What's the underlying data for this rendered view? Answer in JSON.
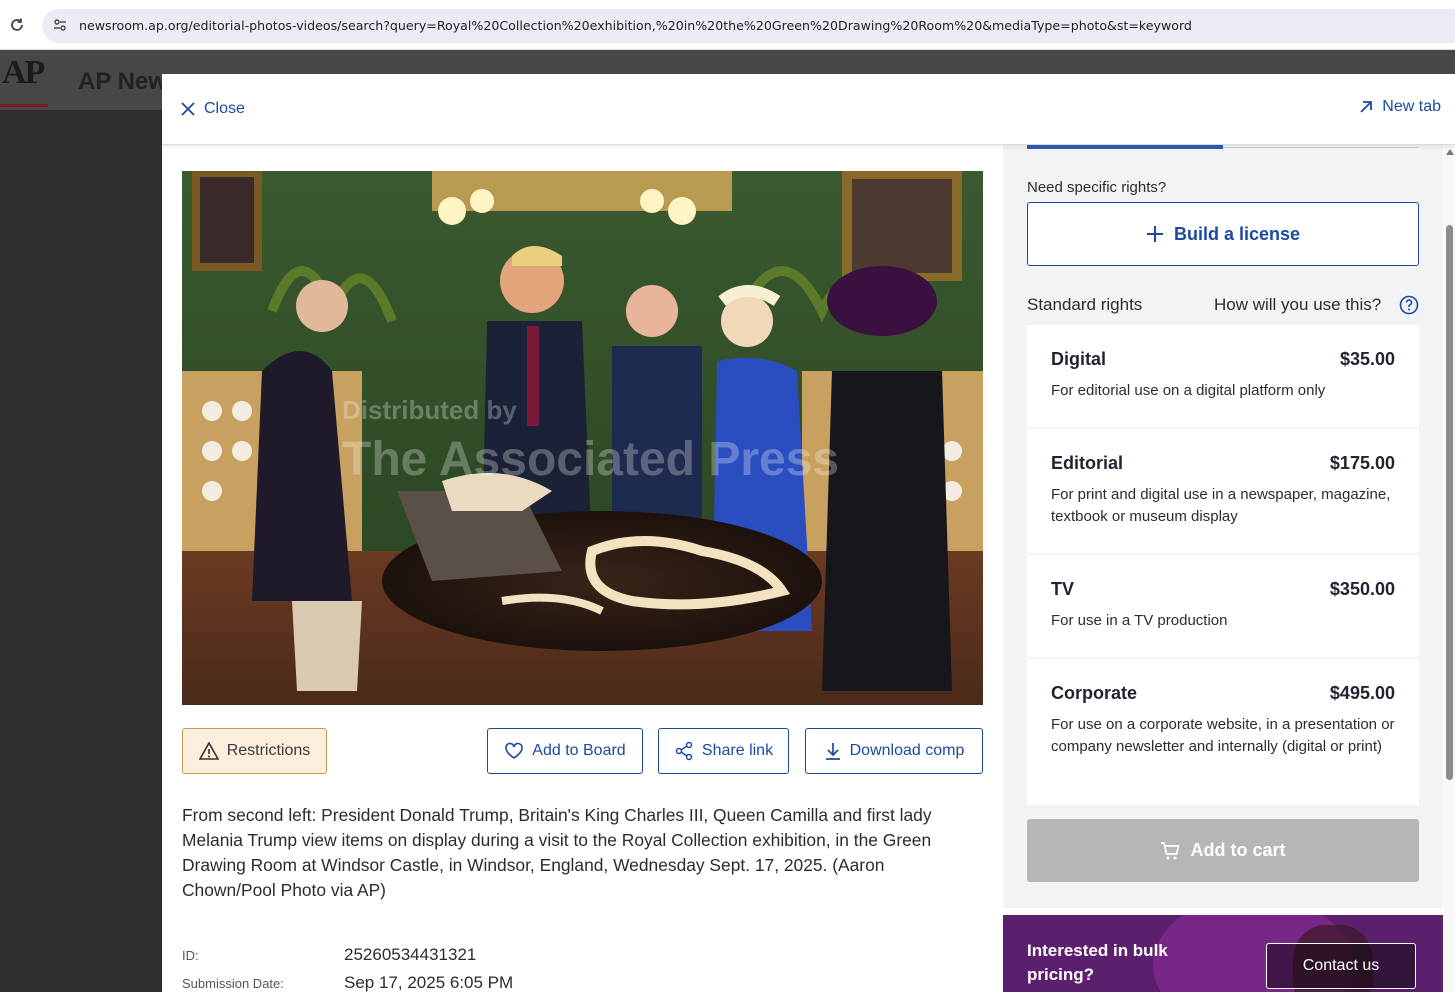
{
  "browser": {
    "url": "newsroom.ap.org/editorial-photos-videos/search?query=Royal%20Collection%20exhibition,%20in%20the%20Green%20Drawing%20Room%20&mediaType=photo&st=keyword"
  },
  "background": {
    "logo": "AP",
    "title": "AP News"
  },
  "modal": {
    "close_label": "Close",
    "newtab_label": "New tab",
    "photo": {
      "watermark_line1": "Distributed by",
      "watermark_line2": "The Associated Press"
    },
    "actions": {
      "restrictions": "Restrictions",
      "add_to_board": "Add to Board",
      "share_link": "Share link",
      "download_comp": "Download comp"
    },
    "caption": "From second left: President Donald Trump, Britain's King Charles III, Queen Camilla and first lady Melania Trump view items on display during a visit to the Royal Collection exhibition, in the Green Drawing Room at Windsor Castle, in Windsor, England, Wednesday Sept. 17, 2025. (Aaron Chown/Pool Photo via AP)",
    "meta": [
      {
        "key": "ID:",
        "value": "25260534431321"
      },
      {
        "key": "Submission Date:",
        "value": "Sep 17, 2025 6:05 PM"
      }
    ]
  },
  "licensing": {
    "need_label": "Need specific rights?",
    "build_license": "Build a license",
    "standard_rights": "Standard rights",
    "how_use": "How will you use this?",
    "rights": [
      {
        "name": "Digital",
        "price": "$35.00",
        "desc": "For editorial use on a digital platform only"
      },
      {
        "name": "Editorial",
        "price": "$175.00",
        "desc": "For print and digital use in a newspaper, magazine, textbook or museum display"
      },
      {
        "name": "TV",
        "price": "$350.00",
        "desc": "For use in a TV production"
      },
      {
        "name": "Corporate",
        "price": "$495.00",
        "desc": "For use on a corporate website, in a presentation or company newsletter and internally (digital or print)"
      }
    ],
    "add_to_cart": "Add to cart"
  },
  "bulk": {
    "text": "Interested in bulk pricing?",
    "contact": "Contact us"
  },
  "colors": {
    "accent": "#1b4aa0",
    "restrictions_bg": "#fbeedd",
    "disabled_cart": "#b6b6b6",
    "promo_bg": "#5b1f6e"
  }
}
